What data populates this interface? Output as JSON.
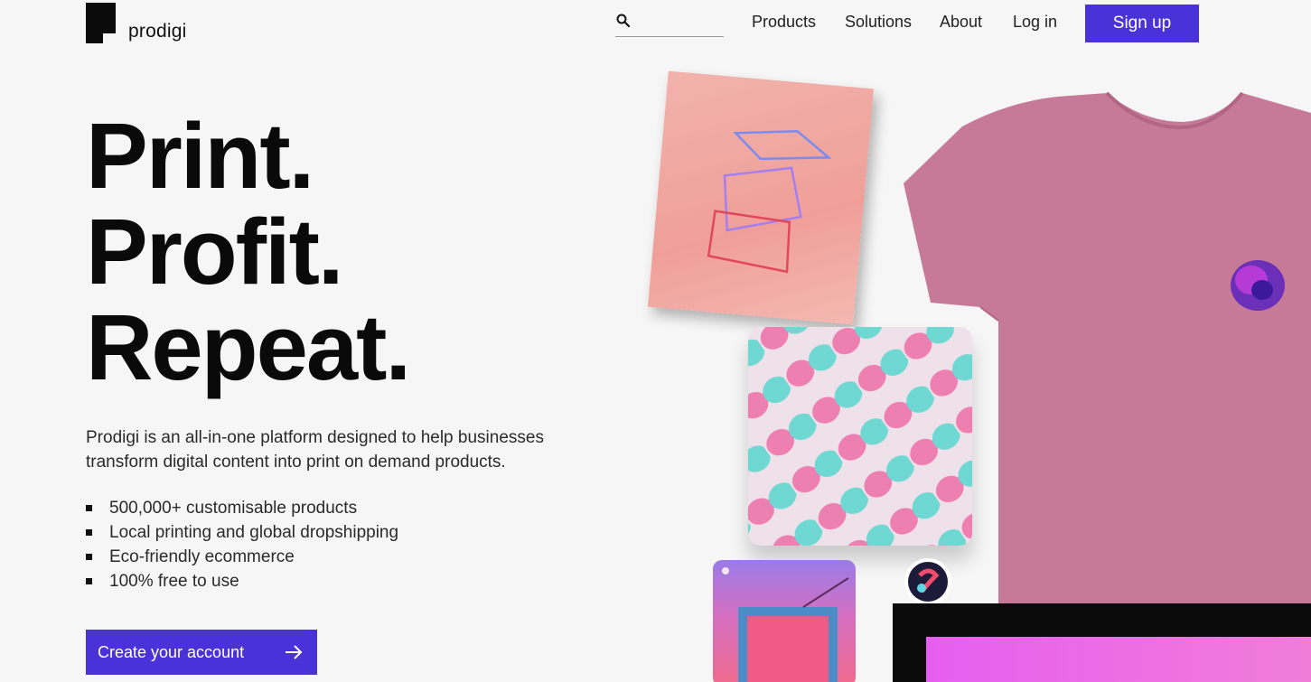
{
  "header": {
    "logo_text": "prodigi",
    "search": {
      "placeholder": "",
      "value": ""
    },
    "nav": {
      "products": "Products",
      "solutions": "Solutions",
      "about": "About",
      "login": "Log in",
      "signup": "Sign up"
    }
  },
  "hero": {
    "headline": [
      "Print.",
      "Profit.",
      "Repeat."
    ],
    "description": "Prodigi is an all-in-one platform designed to help businesses transform digital content into print on demand products.",
    "features": [
      "500,000+ customisable products",
      "Local printing and global dropshipping",
      "Eco-friendly ecommerce",
      "100% free to use"
    ],
    "cta_label": "Create your account"
  },
  "colors": {
    "accent": "#4a32d9",
    "background": "#f6f6f6",
    "tshirt": "#c67a97"
  },
  "icons": {
    "search": "search-icon",
    "cta_arrow": "arrow-right-icon",
    "logo": "prodigi-logo-icon"
  }
}
